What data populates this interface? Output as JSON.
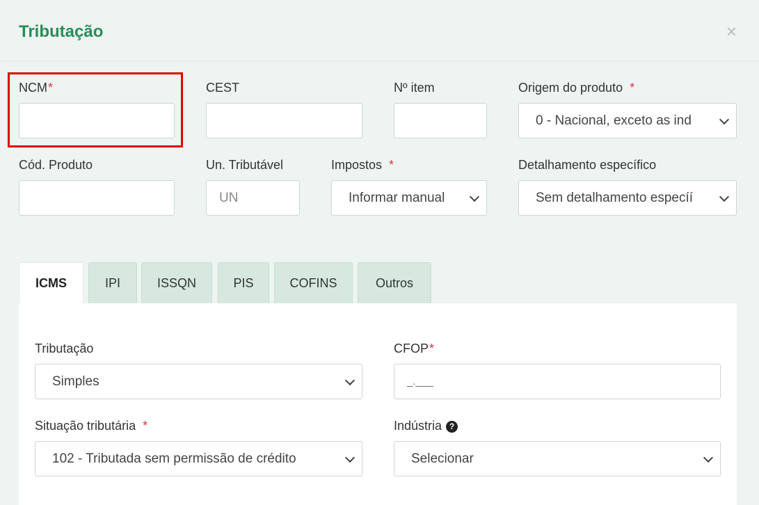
{
  "modal": {
    "title": "Tributação",
    "close_label": "×"
  },
  "fields": {
    "ncm": {
      "label": "NCM",
      "required": "*",
      "value": ""
    },
    "cest": {
      "label": "CEST",
      "value": ""
    },
    "item_no": {
      "label": "Nº item",
      "value": ""
    },
    "origem": {
      "label": "Origem do produto",
      "required": "*",
      "value": "0 - Nacional, exceto as ind"
    },
    "cod_produto": {
      "label": "Cód. Produto",
      "value": ""
    },
    "un_tributavel": {
      "label": "Un. Tributável",
      "placeholder": "UN"
    },
    "impostos": {
      "label": "Impostos",
      "required": "*",
      "value": "Informar manual"
    },
    "detalhamento": {
      "label": "Detalhamento específico",
      "value": "Sem detalhamento especíí"
    }
  },
  "tabs": [
    {
      "label": "ICMS",
      "active": true
    },
    {
      "label": "IPI"
    },
    {
      "label": "ISSQN"
    },
    {
      "label": "PIS"
    },
    {
      "label": "COFINS"
    },
    {
      "label": "Outros"
    }
  ],
  "icms": {
    "tributacao": {
      "label": "Tributação",
      "value": "Simples"
    },
    "cfop": {
      "label": "CFOP",
      "required": "*",
      "placeholder": "_.___"
    },
    "situacao": {
      "label": "Situação tributária",
      "required": "*",
      "value": "102 - Tributada sem permissão de crédito"
    },
    "industria": {
      "label": "Indústria",
      "info_icon": "?",
      "value": "Selecionar"
    }
  },
  "colors": {
    "accent": "#2a8c5b",
    "required": "#dc3545",
    "highlight": "#e10000",
    "tab_bg": "#d6e8e0"
  }
}
